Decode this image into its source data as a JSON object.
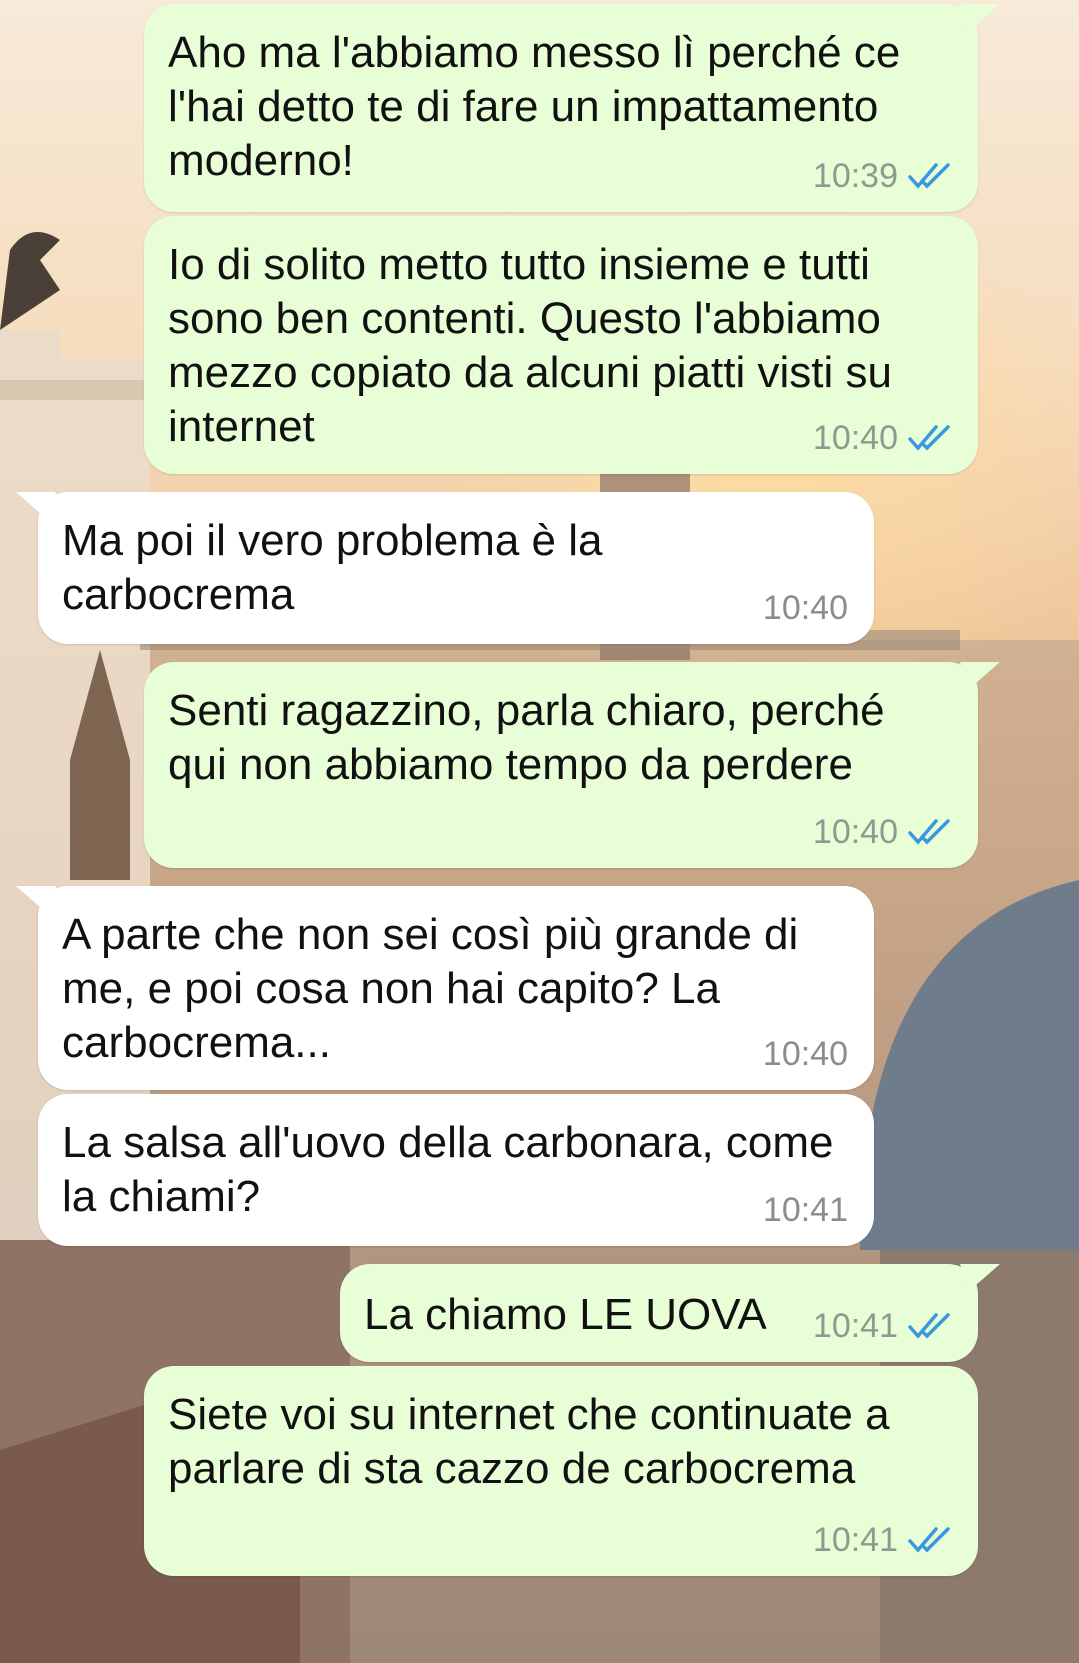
{
  "colors": {
    "outgoing_bubble": "#e7fed6",
    "incoming_bubble": "#ffffff",
    "read_tick": "#3b97e0",
    "timestamp": "#8e9a90"
  },
  "messages": [
    {
      "direction": "out",
      "text": "Aho ma l'abbiamo messo lì perché ce l'hai detto te di fare un impattamento moderno!",
      "time": "10:39",
      "status_icon": "double-check-read-icon"
    },
    {
      "direction": "out",
      "text": "Io di solito metto tutto insieme e tutti sono ben contenti. Questo l'abbiamo mezzo copiato da alcuni piatti visti su internet",
      "time": "10:40",
      "status_icon": "double-check-read-icon"
    },
    {
      "direction": "in",
      "text": "Ma poi il vero problema è la carbocrema",
      "time": "10:40"
    },
    {
      "direction": "out",
      "text": "Senti ragazzino, parla chiaro, perché qui non abbiamo tempo da perdere",
      "time": "10:40",
      "status_icon": "double-check-read-icon"
    },
    {
      "direction": "in",
      "text": "A parte che non sei così più grande di me, e poi cosa non hai capito? La carbocrema...",
      "time": "10:40"
    },
    {
      "direction": "in",
      "text": "La salsa all'uovo della carbonara, come la chiami?",
      "time": "10:41"
    },
    {
      "direction": "out",
      "text": "La chiamo LE UOVA",
      "time": "10:41",
      "status_icon": "double-check-read-icon"
    },
    {
      "direction": "out",
      "text": "Siete voi su internet che continuate a parlare di sta cazzo de carbocrema",
      "time": "10:41",
      "status_icon": "double-check-read-icon"
    }
  ]
}
